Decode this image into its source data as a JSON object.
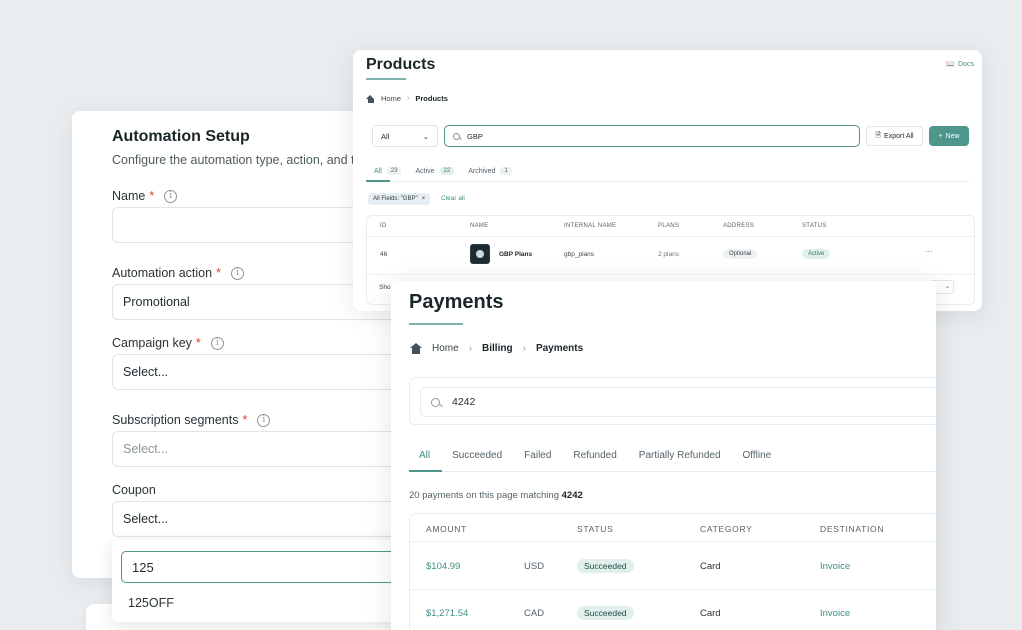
{
  "automation": {
    "title": "Automation Setup",
    "subtitle": "Configure the automation type, action, and ta",
    "fields": {
      "name": {
        "label": "Name",
        "required": "*",
        "value": ""
      },
      "action": {
        "label": "Automation action",
        "required": "*",
        "value": "Promotional"
      },
      "campaign": {
        "label": "Campaign key",
        "required": "*",
        "value": "Select..."
      },
      "segments": {
        "label": "Subscription segments",
        "required": "*",
        "placeholder": "Select..."
      },
      "coupon": {
        "label": "Coupon",
        "value": "Select..."
      }
    },
    "coupon_dropdown": {
      "search_value": "125",
      "options": [
        "125OFF"
      ]
    },
    "info_glyph": "i"
  },
  "products": {
    "title": "Products",
    "docs_label": "Docs",
    "breadcrumb": {
      "home": "Home",
      "current": "Products"
    },
    "filter_select": "All",
    "search_value": "GBP",
    "export_label": "Export All",
    "new_label": "New",
    "tabs": [
      {
        "label": "All",
        "count": "23"
      },
      {
        "label": "Active",
        "count": "22"
      },
      {
        "label": "Archived",
        "count": "1"
      }
    ],
    "filter_chip": "All Fields: \"GBP\"",
    "clear_label": "Clear all",
    "table": {
      "headers": [
        "ID",
        "NAME",
        "INTERNAL NAME",
        "PLANS",
        "ADDRESS",
        "STATUS"
      ],
      "row": {
        "id": "46",
        "name": "GBP Plans",
        "internal_name": "gbp_plans",
        "plans": "2 plans",
        "address": "Optional",
        "status": "Active",
        "menu": "···"
      },
      "footer_text": "Sho"
    }
  },
  "payments": {
    "title": "Payments",
    "breadcrumb": {
      "home": "Home",
      "middle": "Billing",
      "current": "Payments"
    },
    "search_value": "4242",
    "tabs": [
      "All",
      "Succeeded",
      "Failed",
      "Refunded",
      "Partially Refunded",
      "Offline"
    ],
    "summary_prefix": "20 payments on this page matching",
    "summary_query": "4242",
    "table": {
      "headers": [
        "AMOUNT",
        "STATUS",
        "CATEGORY",
        "DESTINATION"
      ],
      "rows": [
        {
          "amount": "$104.99",
          "currency": "USD",
          "status": "Succeeded",
          "category": "Card",
          "destination": "Invoice"
        },
        {
          "amount": "$1,271.54",
          "currency": "CAD",
          "status": "Succeeded",
          "category": "Card",
          "destination": "Invoice"
        }
      ]
    }
  },
  "colors": {
    "accent": "#4e968b",
    "required": "#d2463c",
    "success_bg": "#e1f0ec"
  }
}
